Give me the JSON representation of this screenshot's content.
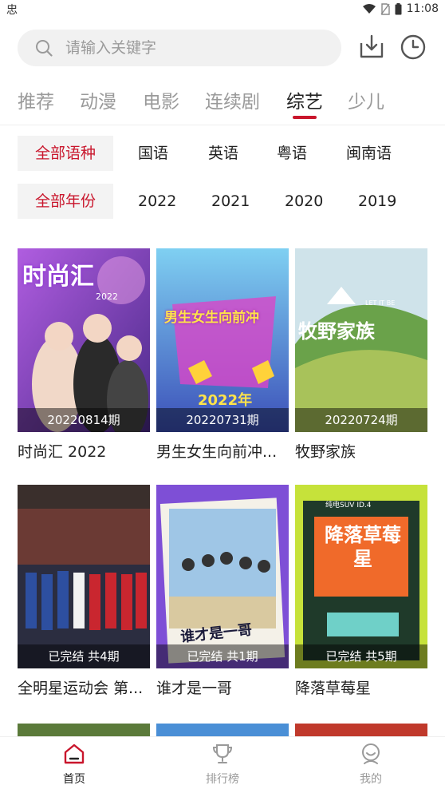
{
  "status": {
    "left_glyph": "忠",
    "time": "11:08"
  },
  "search": {
    "placeholder": "请输入关键字"
  },
  "tabs": [
    {
      "label": "推荐"
    },
    {
      "label": "动漫"
    },
    {
      "label": "电影"
    },
    {
      "label": "连续剧"
    },
    {
      "label": "综艺"
    },
    {
      "label": "少儿"
    }
  ],
  "active_tab": "综艺",
  "filters": {
    "language": [
      "全部语种",
      "国语",
      "英语",
      "粤语",
      "闽南语"
    ],
    "year": [
      "全部年份",
      "2022",
      "2021",
      "2020",
      "2019"
    ]
  },
  "cards": [
    {
      "title": "时尚汇 2022",
      "caption": "20220814期",
      "poster_text": "时尚汇",
      "poster_sub": "2022"
    },
    {
      "title": "男生女生向前冲...",
      "caption": "20220731期",
      "poster_text": "男生女生向前冲",
      "poster_sub": "2022年"
    },
    {
      "title": "牧野家族",
      "caption": "20220724期",
      "poster_text": "牧野家族",
      "poster_sub": "LET IT BE"
    },
    {
      "title": "全明星运动会 第...",
      "caption": "已完结 共4期",
      "poster_text": "",
      "poster_sub": ""
    },
    {
      "title": "谁才是一哥",
      "caption": "已完结 共1期",
      "poster_text": "谁才是一哥",
      "poster_sub": ""
    },
    {
      "title": "降落草莓星",
      "caption": "已完结 共5期",
      "poster_text": "降落草莓星",
      "poster_sub": "纯电SUV ID.4"
    }
  ],
  "bottom_nav": [
    {
      "label": "首页",
      "icon": "home-icon"
    },
    {
      "label": "排行榜",
      "icon": "trophy-icon"
    },
    {
      "label": "我的",
      "icon": "profile-icon"
    }
  ],
  "colors": {
    "accent": "#c9162c",
    "inactive": "#9a9a9a"
  }
}
